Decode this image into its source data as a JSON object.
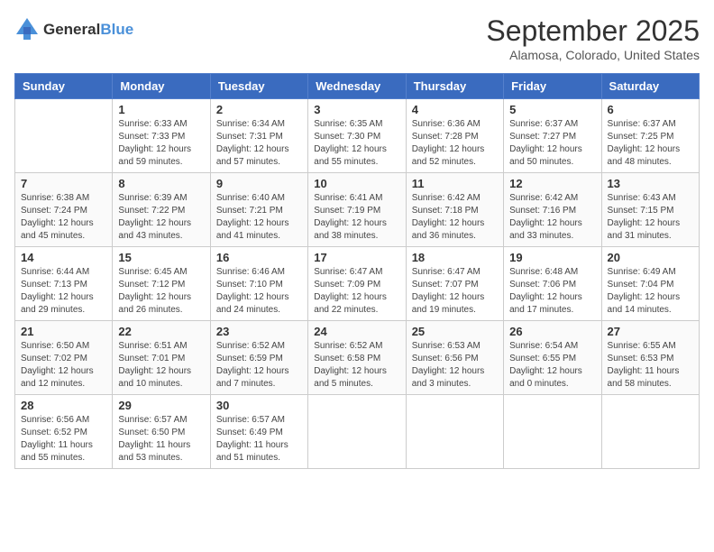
{
  "header": {
    "logo": {
      "general": "General",
      "blue": "Blue"
    },
    "month": "September 2025",
    "location": "Alamosa, Colorado, United States"
  },
  "weekdays": [
    "Sunday",
    "Monday",
    "Tuesday",
    "Wednesday",
    "Thursday",
    "Friday",
    "Saturday"
  ],
  "weeks": [
    [
      {
        "day": "",
        "sunrise": "",
        "sunset": "",
        "daylight": "",
        "empty": true
      },
      {
        "day": "1",
        "sunrise": "Sunrise: 6:33 AM",
        "sunset": "Sunset: 7:33 PM",
        "daylight": "Daylight: 12 hours and 59 minutes."
      },
      {
        "day": "2",
        "sunrise": "Sunrise: 6:34 AM",
        "sunset": "Sunset: 7:31 PM",
        "daylight": "Daylight: 12 hours and 57 minutes."
      },
      {
        "day": "3",
        "sunrise": "Sunrise: 6:35 AM",
        "sunset": "Sunset: 7:30 PM",
        "daylight": "Daylight: 12 hours and 55 minutes."
      },
      {
        "day": "4",
        "sunrise": "Sunrise: 6:36 AM",
        "sunset": "Sunset: 7:28 PM",
        "daylight": "Daylight: 12 hours and 52 minutes."
      },
      {
        "day": "5",
        "sunrise": "Sunrise: 6:37 AM",
        "sunset": "Sunset: 7:27 PM",
        "daylight": "Daylight: 12 hours and 50 minutes."
      },
      {
        "day": "6",
        "sunrise": "Sunrise: 6:37 AM",
        "sunset": "Sunset: 7:25 PM",
        "daylight": "Daylight: 12 hours and 48 minutes."
      }
    ],
    [
      {
        "day": "7",
        "sunrise": "Sunrise: 6:38 AM",
        "sunset": "Sunset: 7:24 PM",
        "daylight": "Daylight: 12 hours and 45 minutes."
      },
      {
        "day": "8",
        "sunrise": "Sunrise: 6:39 AM",
        "sunset": "Sunset: 7:22 PM",
        "daylight": "Daylight: 12 hours and 43 minutes."
      },
      {
        "day": "9",
        "sunrise": "Sunrise: 6:40 AM",
        "sunset": "Sunset: 7:21 PM",
        "daylight": "Daylight: 12 hours and 41 minutes."
      },
      {
        "day": "10",
        "sunrise": "Sunrise: 6:41 AM",
        "sunset": "Sunset: 7:19 PM",
        "daylight": "Daylight: 12 hours and 38 minutes."
      },
      {
        "day": "11",
        "sunrise": "Sunrise: 6:42 AM",
        "sunset": "Sunset: 7:18 PM",
        "daylight": "Daylight: 12 hours and 36 minutes."
      },
      {
        "day": "12",
        "sunrise": "Sunrise: 6:42 AM",
        "sunset": "Sunset: 7:16 PM",
        "daylight": "Daylight: 12 hours and 33 minutes."
      },
      {
        "day": "13",
        "sunrise": "Sunrise: 6:43 AM",
        "sunset": "Sunset: 7:15 PM",
        "daylight": "Daylight: 12 hours and 31 minutes."
      }
    ],
    [
      {
        "day": "14",
        "sunrise": "Sunrise: 6:44 AM",
        "sunset": "Sunset: 7:13 PM",
        "daylight": "Daylight: 12 hours and 29 minutes."
      },
      {
        "day": "15",
        "sunrise": "Sunrise: 6:45 AM",
        "sunset": "Sunset: 7:12 PM",
        "daylight": "Daylight: 12 hours and 26 minutes."
      },
      {
        "day": "16",
        "sunrise": "Sunrise: 6:46 AM",
        "sunset": "Sunset: 7:10 PM",
        "daylight": "Daylight: 12 hours and 24 minutes."
      },
      {
        "day": "17",
        "sunrise": "Sunrise: 6:47 AM",
        "sunset": "Sunset: 7:09 PM",
        "daylight": "Daylight: 12 hours and 22 minutes."
      },
      {
        "day": "18",
        "sunrise": "Sunrise: 6:47 AM",
        "sunset": "Sunset: 7:07 PM",
        "daylight": "Daylight: 12 hours and 19 minutes."
      },
      {
        "day": "19",
        "sunrise": "Sunrise: 6:48 AM",
        "sunset": "Sunset: 7:06 PM",
        "daylight": "Daylight: 12 hours and 17 minutes."
      },
      {
        "day": "20",
        "sunrise": "Sunrise: 6:49 AM",
        "sunset": "Sunset: 7:04 PM",
        "daylight": "Daylight: 12 hours and 14 minutes."
      }
    ],
    [
      {
        "day": "21",
        "sunrise": "Sunrise: 6:50 AM",
        "sunset": "Sunset: 7:02 PM",
        "daylight": "Daylight: 12 hours and 12 minutes."
      },
      {
        "day": "22",
        "sunrise": "Sunrise: 6:51 AM",
        "sunset": "Sunset: 7:01 PM",
        "daylight": "Daylight: 12 hours and 10 minutes."
      },
      {
        "day": "23",
        "sunrise": "Sunrise: 6:52 AM",
        "sunset": "Sunset: 6:59 PM",
        "daylight": "Daylight: 12 hours and 7 minutes."
      },
      {
        "day": "24",
        "sunrise": "Sunrise: 6:52 AM",
        "sunset": "Sunset: 6:58 PM",
        "daylight": "Daylight: 12 hours and 5 minutes."
      },
      {
        "day": "25",
        "sunrise": "Sunrise: 6:53 AM",
        "sunset": "Sunset: 6:56 PM",
        "daylight": "Daylight: 12 hours and 3 minutes."
      },
      {
        "day": "26",
        "sunrise": "Sunrise: 6:54 AM",
        "sunset": "Sunset: 6:55 PM",
        "daylight": "Daylight: 12 hours and 0 minutes."
      },
      {
        "day": "27",
        "sunrise": "Sunrise: 6:55 AM",
        "sunset": "Sunset: 6:53 PM",
        "daylight": "Daylight: 11 hours and 58 minutes."
      }
    ],
    [
      {
        "day": "28",
        "sunrise": "Sunrise: 6:56 AM",
        "sunset": "Sunset: 6:52 PM",
        "daylight": "Daylight: 11 hours and 55 minutes."
      },
      {
        "day": "29",
        "sunrise": "Sunrise: 6:57 AM",
        "sunset": "Sunset: 6:50 PM",
        "daylight": "Daylight: 11 hours and 53 minutes."
      },
      {
        "day": "30",
        "sunrise": "Sunrise: 6:57 AM",
        "sunset": "Sunset: 6:49 PM",
        "daylight": "Daylight: 11 hours and 51 minutes."
      },
      {
        "day": "",
        "sunrise": "",
        "sunset": "",
        "daylight": "",
        "empty": true
      },
      {
        "day": "",
        "sunrise": "",
        "sunset": "",
        "daylight": "",
        "empty": true
      },
      {
        "day": "",
        "sunrise": "",
        "sunset": "",
        "daylight": "",
        "empty": true
      },
      {
        "day": "",
        "sunrise": "",
        "sunset": "",
        "daylight": "",
        "empty": true
      }
    ]
  ]
}
